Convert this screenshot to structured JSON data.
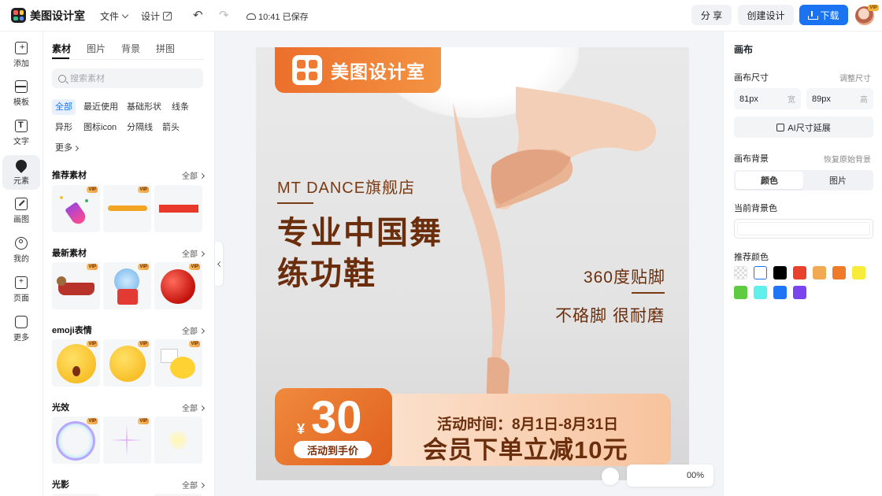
{
  "header": {
    "app_name": "美图设计室",
    "menu_file": "文件",
    "menu_design": "设计",
    "save_status": "10:41 已保存",
    "share_label": "分 享",
    "create_label": "创建设计",
    "download_label": "下载",
    "avatar_badge": "VIP"
  },
  "rail": {
    "items": [
      {
        "label": "添加",
        "icon": "add-icon"
      },
      {
        "label": "模板",
        "icon": "template-icon"
      },
      {
        "label": "文字",
        "icon": "text-icon"
      },
      {
        "label": "元素",
        "icon": "element-icon"
      },
      {
        "label": "画图",
        "icon": "draw-icon"
      },
      {
        "label": "我的",
        "icon": "user-icon"
      },
      {
        "label": "页面",
        "icon": "page-icon"
      },
      {
        "label": "更多",
        "icon": "more-icon"
      }
    ]
  },
  "panel": {
    "tabs": [
      "素材",
      "图片",
      "背景",
      "拼图"
    ],
    "search_placeholder": "搜索素材",
    "chips": [
      "全部",
      "最近使用",
      "基础形状",
      "线条",
      "异形",
      "图标icon",
      "分隔线",
      "箭头",
      "更多"
    ],
    "see_all": "全部",
    "vip": "VIP",
    "sections": [
      "推荐素材",
      "最新素材",
      "emoji表情",
      "光效",
      "光影"
    ]
  },
  "poster": {
    "brand": "美图设计室",
    "store": "MT DANCE旗舰店",
    "headline_1": "专业中国舞",
    "headline_2": "练功鞋",
    "feature_1": "360度贴脚",
    "feature_2": "不硌脚 很耐磨",
    "currency": "¥",
    "price": "30",
    "price_tag": "活动到手价",
    "date": "活动时间：8月1日-8月31日",
    "promo": "会员下单立减10元"
  },
  "zoom": {
    "value": "00%"
  },
  "right": {
    "title": "画布",
    "size_label": "画布尺寸",
    "resize_link": "调整尺寸",
    "width_value": "81px",
    "width_unit": "宽",
    "height_value": "89px",
    "height_unit": "高",
    "ai_extend": "AI尺寸延展",
    "bg_label": "画布背景",
    "restore_link": "恢复原始背景",
    "seg_color": "颜色",
    "seg_image": "图片",
    "current_color_label": "当前背景色",
    "recommend_label": "推荐颜色",
    "swatches": [
      "transparent",
      "#ffffff",
      "#000000",
      "#e8412c",
      "#f2aa52",
      "#ef7b2a",
      "#f8ec3b",
      "#5ecb40",
      "#5ff0ec",
      "#1f75f3",
      "#7a45ee"
    ]
  }
}
